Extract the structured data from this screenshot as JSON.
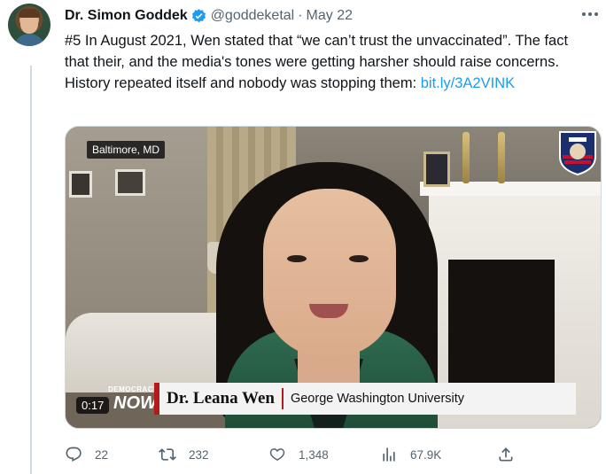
{
  "tweet": {
    "author_name": "Dr. Simon Goddek",
    "handle": "@goddeketal",
    "separator": "·",
    "date": "May 22",
    "text_main": "#5 In August 2021, Wen stated that “we can’t trust the unvaccinated”. The fact that their, and the media's tones were getting harsher should raise concerns. History repeated itself and nobody was stopping them: ",
    "text_link": "bit.ly/3A2VINK"
  },
  "media": {
    "location_label": "Baltimore, MD",
    "lower_third_name": "Dr. Leana Wen",
    "lower_third_org": "George Washington University",
    "show_logo_small": "DEMOCRACY",
    "show_logo_big": "NOW!",
    "timestamp": "0:17"
  },
  "actions": {
    "replies": "22",
    "retweets": "232",
    "likes": "1,348",
    "views": "67.9K"
  },
  "colors": {
    "link": "#1d9bf0",
    "muted": "#536471",
    "verified": "#1d9bf0",
    "lower_third_accent": "#b31b1b"
  },
  "icons": [
    "verified-badge-icon",
    "more-options-icon",
    "reply-icon",
    "retweet-icon",
    "like-icon",
    "views-icon",
    "share-icon"
  ]
}
